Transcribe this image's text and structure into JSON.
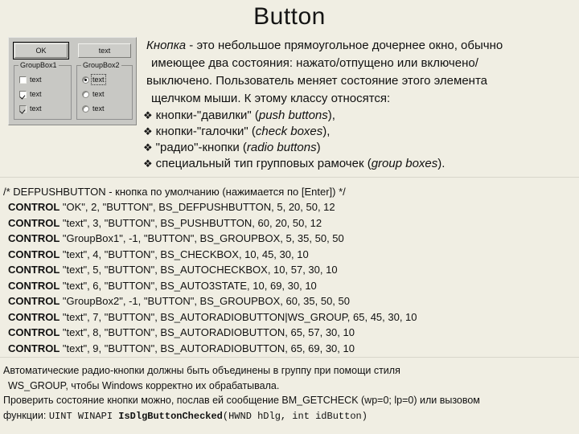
{
  "title": "Button",
  "dialog": {
    "buttons": [
      {
        "label": "OK",
        "style": "default"
      },
      {
        "label": "text",
        "style": "normal"
      }
    ],
    "groupbox1": {
      "label": "GroupBox1",
      "items": [
        {
          "label": "text",
          "state": "unchecked"
        },
        {
          "label": "text",
          "state": "checked"
        },
        {
          "label": "text",
          "state": "checked-gray"
        }
      ]
    },
    "groupbox2": {
      "label": "GroupBox2",
      "items": [
        {
          "label": "text",
          "state": "selected",
          "focus": true
        },
        {
          "label": "text",
          "state": "unselected",
          "focus": false
        },
        {
          "label": "text",
          "state": "unselected",
          "focus": false
        }
      ]
    }
  },
  "intro": {
    "term": "Кнопка",
    "line1_rest": " - это небольшое прямоугольное дочернее окно, обычно",
    "line2": "имеющее два состояния: нажато/отпущено или включено/",
    "line3": "выключено. Пользователь меняет состояние этого элемента",
    "line4": "щелчком мыши. К этому классу относятся:"
  },
  "bullets": {
    "glyph": "❖",
    "items": [
      {
        "ru": "кнопки-\"давилки\" (",
        "en": "push buttons",
        "tail": "),"
      },
      {
        "ru": "кнопки-\"галочки\" (",
        "en": "check boxes",
        "tail": "),"
      },
      {
        "ru": "\"радио\"-кнопки (",
        "en": "radio buttons",
        "tail": ")"
      },
      {
        "ru": "специальный тип групповых рамочек (",
        "en": "group boxes",
        "tail": ")."
      }
    ]
  },
  "code": {
    "comment": "/* DEFPUSHBUTTON - кнопка по умолчанию (нажимается по [Enter]) */",
    "keyword": "CONTROL",
    "lines": [
      " \"OK\", 2, \"BUTTON\", BS_DEFPUSHBUTTON, 5, 20, 50, 12",
      " \"text\", 3, \"BUTTON\", BS_PUSHBUTTON, 60, 20, 50, 12",
      " \"GroupBox1\", -1, \"BUTTON\", BS_GROUPBOX, 5, 35, 50, 50",
      " \"text\", 4, \"BUTTON\", BS_CHECKBOX, 10, 45, 30, 10",
      " \"text\", 5, \"BUTTON\", BS_AUTOCHECKBOX, 10, 57, 30, 10",
      " \"text\", 6, \"BUTTON\", BS_AUTO3STATE, 10, 69, 30, 10",
      " \"GroupBox2\", -1, \"BUTTON\", BS_GROUPBOX, 60, 35, 50, 50",
      " \"text\", 7, \"BUTTON\", BS_AUTORADIOBUTTON|WS_GROUP, 65, 45, 30, 10",
      " \"text\", 8, \"BUTTON\", BS_AUTORADIOBUTTON, 65, 57, 30, 10",
      " \"text\", 9, \"BUTTON\", BS_AUTORADIOBUTTON, 65, 69, 30, 10"
    ]
  },
  "footer": {
    "line1": "Автоматические радио-кнопки должны быть объединены в группу при помощи стиля",
    "line2": "WS_GROUP, чтобы Windows корректно их обрабатывала.",
    "line3": "Проверить состояние кнопки можно, послав ей сообщение BM_GETCHECK (wp=0; lp=0) или вызовом",
    "line4_prefix": "функции: ",
    "line4_mono1": "UINT WINAPI ",
    "line4_bold": "IsDlgButtonChecked",
    "line4_mono2": "(HWND hDlg, int idButton)"
  },
  "colors": {
    "background": "#f0eee3",
    "dialog_face": "#c8c8c4",
    "text": "#111111"
  }
}
